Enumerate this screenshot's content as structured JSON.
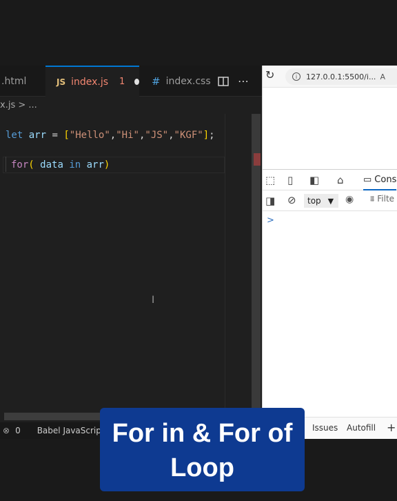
{
  "editor": {
    "tabs": [
      {
        "label": ".html"
      },
      {
        "label": "index.js",
        "icon_text": "JS",
        "problems": "1",
        "modified": true
      },
      {
        "label": "index.css"
      }
    ],
    "breadcrumb": "x.js > ...",
    "code": {
      "line1": {
        "kw": "let",
        "var": "arr",
        "eq": "=",
        "open": "[",
        "s1": "\"Hello\"",
        "s2": "\"Hi\"",
        "s3": "\"JS\"",
        "s4": "\"KGF\"",
        "close": "]",
        "semi": ";"
      },
      "line2": {
        "kw": "for",
        "open": "(",
        "var1": "data",
        "in": "in",
        "var2": "arr",
        "close": ")"
      }
    },
    "status": {
      "errors": "0",
      "language": "Babel JavaScript"
    }
  },
  "browser": {
    "url": "127.0.0.1:5500/i...",
    "devtools": {
      "console_tab": "Cons",
      "context": "top",
      "filter": "Filte",
      "prompt": ">",
      "drawer_tabs": [
        "Issues",
        "Autofill"
      ],
      "add": "+"
    }
  },
  "caption": {
    "line1": "For in & For of",
    "line2": "Loop"
  },
  "colors": {
    "caption_bg": "#0e3a91",
    "accent": "#0078d4"
  }
}
